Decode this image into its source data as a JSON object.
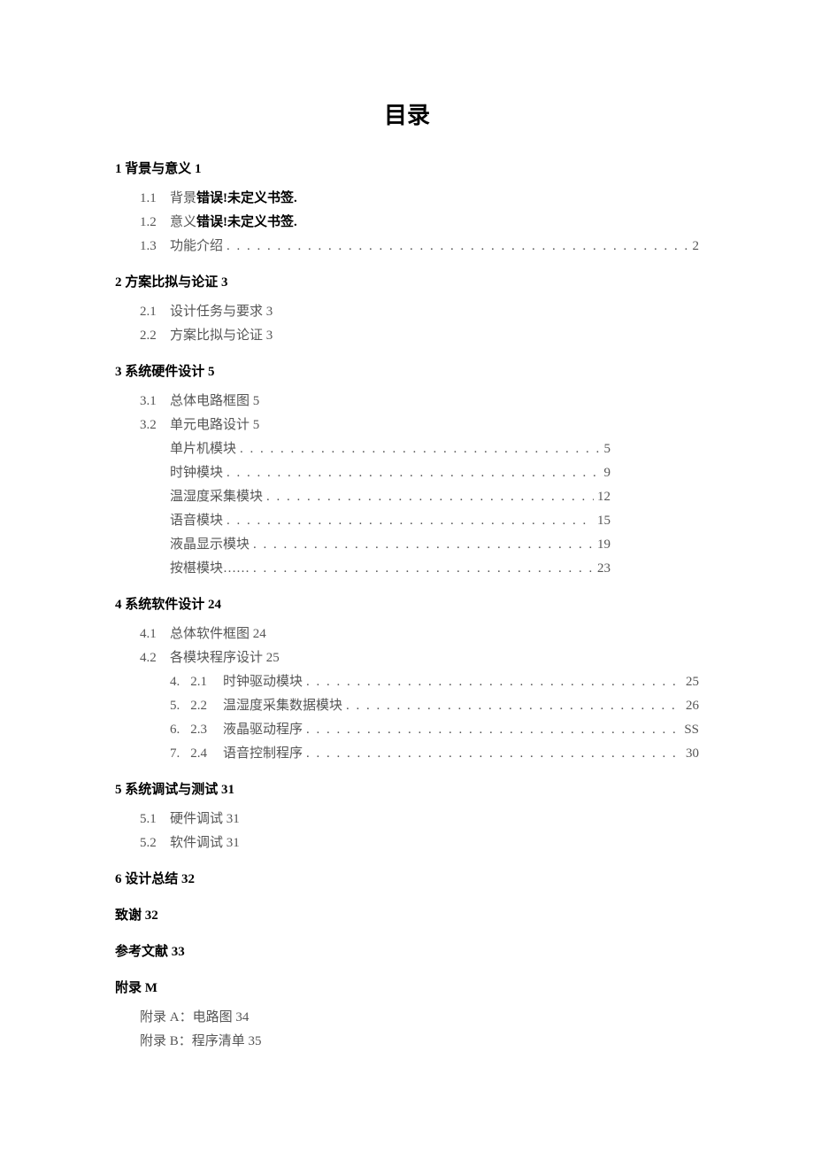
{
  "title": "目录",
  "sections": [
    {
      "heading": "1 背景与意义 1",
      "subs": [
        {
          "idx": "1.1",
          "label": "背景",
          "error": "错误!未定义书签."
        },
        {
          "idx": "1.2",
          "label": "意义",
          "error": "错误!未定义书签."
        },
        {
          "idx": "1.3",
          "label": "功能介绍",
          "dots": true,
          "page": "2"
        }
      ]
    },
    {
      "heading": "2 方案比拟与论证 3",
      "subs": [
        {
          "idx": "2.1",
          "label": "设计任务与要求 3"
        },
        {
          "idx": "2.2",
          "label": "方案比拟与论证 3"
        }
      ]
    },
    {
      "heading": "3 系统硬件设计 5",
      "subs": [
        {
          "idx": "3.1",
          "label": "总体电路框图 5"
        },
        {
          "idx": "3.2",
          "label": "单元电路设计 5"
        }
      ],
      "modules": [
        {
          "label": "单片机模块",
          "page": "5"
        },
        {
          "label": "时钟模块",
          "page": "9"
        },
        {
          "label": "温湿度采集模块",
          "page": "12"
        },
        {
          "label": "语音模块",
          "page": "15"
        },
        {
          "label": "液晶显示模块",
          "page": "19"
        },
        {
          "label": "按椹模块……",
          "page": "23"
        }
      ]
    },
    {
      "heading": "4 系统软件设计 24",
      "subs": [
        {
          "idx": "4.1",
          "label": "总体软件框图 24"
        },
        {
          "idx": "4.2",
          "label": "各模块程序设计 25"
        }
      ],
      "subsubs": [
        {
          "prefix": "4.",
          "num": "2.1",
          "label": "时钟驱动模块",
          "page": "25"
        },
        {
          "prefix": "5.",
          "num": "2.2",
          "label": "温湿度采集数据模块",
          "page": "26"
        },
        {
          "prefix": "6.",
          "num": "2.3",
          "label": "液晶驱动程序",
          "page": "SS"
        },
        {
          "prefix": "7.",
          "num": "2.4",
          "label": "语音控制程序",
          "page": "30"
        }
      ]
    },
    {
      "heading": "5 系统调试与测试 31",
      "subs": [
        {
          "idx": "5.1",
          "label": "硬件调试 31"
        },
        {
          "idx": "5.2",
          "label": "软件调试 31"
        }
      ]
    },
    {
      "heading": "6 设计总结 32"
    },
    {
      "heading": "致谢 32"
    },
    {
      "heading": "参考文献 33"
    },
    {
      "heading": "附录 M",
      "appendix": [
        "附录 A：电路图 34",
        "附录 B：程序清单 35"
      ]
    }
  ]
}
